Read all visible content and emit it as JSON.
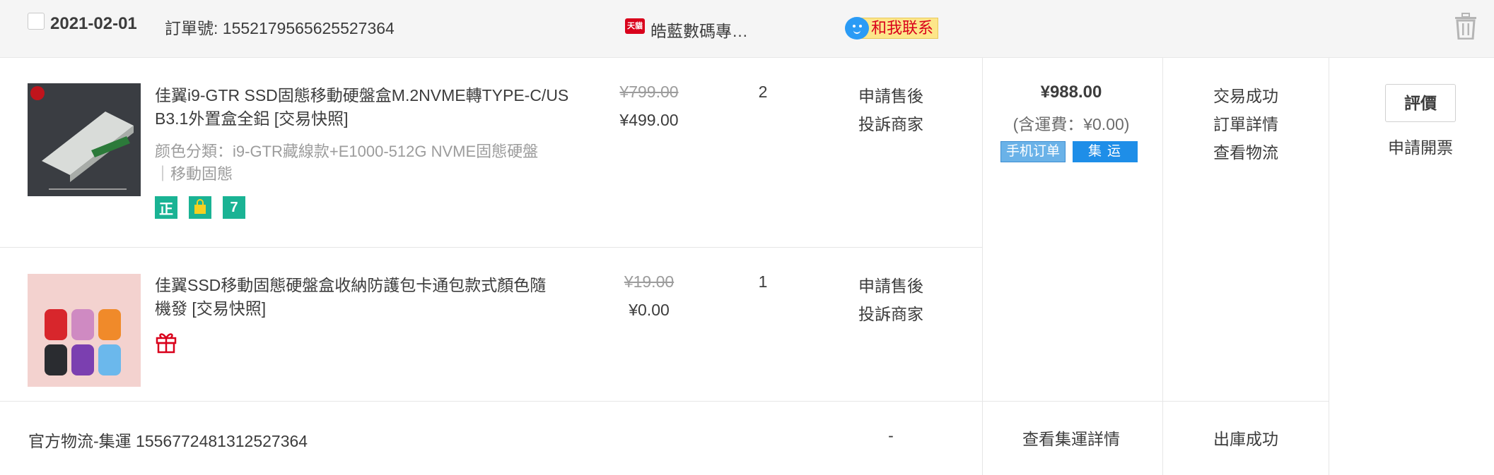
{
  "order": {
    "date": "2021-02-01",
    "order_number": "訂單號: 1552179565625527364",
    "shop_badge": "天貓",
    "shop_name": "皓藍數碼專…",
    "contact_label": "和我联系"
  },
  "items": [
    {
      "title": "佳翼i9-GTR SSD固態移動硬盤盒M.2NVME轉TYPE-C/USB3.1外置盒全鋁 [交易快照]",
      "title_line1": "佳翼i9-GTR SSD固態移動硬盤盒M.2NVME轉TYPE-C/US",
      "title_line2": "B3.1外置盒全鋁 [交易快照]",
      "sku_line1": "颜色分類：i9-GTR藏線款+E1000-512G NVME固態硬盤",
      "sku_line2": "｜移動固態",
      "badges": [
        {
          "icon": "authentic-icon",
          "text": "正",
          "color": "#1ab394"
        },
        {
          "icon": "shopping-bag-icon",
          "text": "",
          "color": "#1ab394"
        },
        {
          "icon": "seven-day-return-icon",
          "text": "7",
          "color": "#1ab394"
        }
      ],
      "original_price": "¥799.00",
      "price": "¥499.00",
      "quantity": "2",
      "actions": [
        "申請售後",
        "投訴商家"
      ]
    },
    {
      "title_line1": "佳翼SSD移動固態硬盤盒收納防護包卡通包款式顏色隨",
      "title_line2": "機發 [交易快照]",
      "badges": [
        {
          "icon": "gift-icon",
          "text": "",
          "color": "#d9001b"
        }
      ],
      "original_price": "¥19.00",
      "price": "¥0.00",
      "quantity": "1",
      "actions": [
        "申請售後",
        "投訴商家"
      ]
    }
  ],
  "summary": {
    "total": "¥988.00",
    "shipping": "(含運費：¥0.00)",
    "tag_mobile": "手机订单",
    "tag_consolidated": "集运"
  },
  "status": {
    "state": "交易成功",
    "detail": "訂單詳情",
    "logistics": "查看物流"
  },
  "operations": {
    "review": "評價",
    "invoice": "申請開票"
  },
  "footer": {
    "logistics_label": "官方物流-集運 1556772481312527364",
    "dash": "-",
    "consolidation_detail": "查看集運詳情",
    "outbound_status": "出庫成功"
  },
  "colors": {
    "header_bg": "#f5f5f5",
    "tmall_red": "#d9001b",
    "contact_blue": "#2a9bf5",
    "consol_blue": "#1e8ee8",
    "badge_green": "#1ab394"
  }
}
